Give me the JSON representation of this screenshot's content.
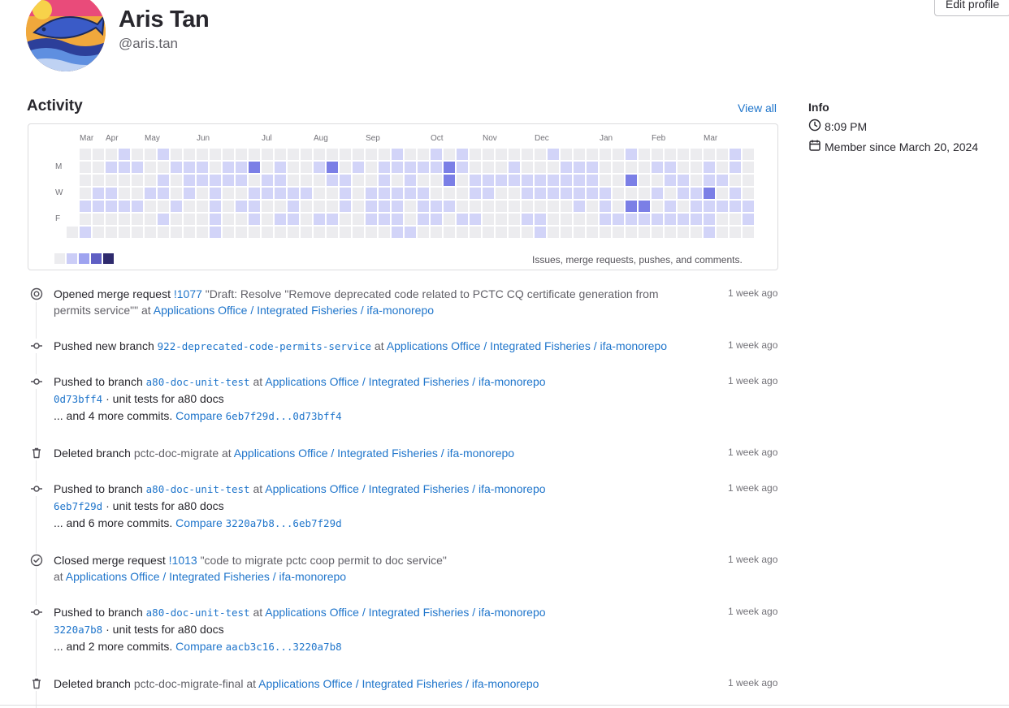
{
  "profile": {
    "name": "Aris Tan",
    "handle": "@aris.tan",
    "edit_label": "Edit profile"
  },
  "activity": {
    "title": "Activity",
    "view_all": "View all",
    "months": [
      "Mar",
      "Apr",
      "May",
      "Jun",
      "Jul",
      "Aug",
      "Sep",
      "Oct",
      "Nov",
      "Dec",
      "Jan",
      "Feb",
      "Mar"
    ],
    "day_labels": [
      "M",
      "W",
      "F"
    ],
    "legend_text": "Issues, merge requests, pushes, and comments.",
    "legend_colors": [
      "#ececef",
      "#cbcdf7",
      "#9ea3f0",
      "#5f5fc4",
      "#2e2a6d"
    ]
  },
  "info": {
    "title": "Info",
    "time": "8:09 PM",
    "member_since": "Member since March 20, 2024"
  },
  "events": [
    {
      "icon": "merge-request-open-icon",
      "lines": [
        [
          {
            "t": "Opened merge request "
          },
          {
            "t": "!1077",
            "link": true
          },
          {
            "t": " \"Draft: Resolve \"Remove deprecated code related to PCTC CQ certificate generation from",
            "muted": true
          }
        ],
        [
          {
            "t": "permits service\"\"",
            "muted": true
          },
          {
            "t": " at ",
            "muted": true
          },
          {
            "t": "Applications Office / Integrated Fisheries / ifa-monorepo",
            "link": true
          }
        ]
      ],
      "time": "1 week ago"
    },
    {
      "icon": "commit-icon",
      "lines": [
        [
          {
            "t": "Pushed new branch "
          },
          {
            "t": "922-deprecated-code-permits-service",
            "code": true
          },
          {
            "t": " at ",
            "muted": true
          },
          {
            "t": "Applications Office / Integrated Fisheries / ifa-monorepo",
            "link": true
          }
        ]
      ],
      "time": "1 week ago"
    },
    {
      "icon": "commit-icon",
      "lines": [
        [
          {
            "t": "Pushed to branch "
          },
          {
            "t": "a80-doc-unit-test",
            "code": true
          },
          {
            "t": " at ",
            "muted": true
          },
          {
            "t": "Applications Office / Integrated Fisheries / ifa-monorepo",
            "link": true
          }
        ],
        [
          {
            "t": "0d73bff4",
            "code": true
          },
          {
            "t": " · unit tests for a80 docs"
          }
        ],
        [
          {
            "t": "... and 4 more commits. "
          },
          {
            "t": "Compare ",
            "link": true
          },
          {
            "t": "6eb7f29d...0d73bff4",
            "code": true
          }
        ]
      ],
      "time": "1 week ago"
    },
    {
      "icon": "trash-icon",
      "lines": [
        [
          {
            "t": "Deleted branch "
          },
          {
            "t": "pctc-doc-migrate",
            "muted": true
          },
          {
            "t": " at ",
            "muted": true
          },
          {
            "t": "Applications Office / Integrated Fisheries / ifa-monorepo",
            "link": true
          }
        ]
      ],
      "time": "1 week ago"
    },
    {
      "icon": "commit-icon",
      "lines": [
        [
          {
            "t": "Pushed to branch "
          },
          {
            "t": "a80-doc-unit-test",
            "code": true
          },
          {
            "t": " at ",
            "muted": true
          },
          {
            "t": "Applications Office / Integrated Fisheries / ifa-monorepo",
            "link": true
          }
        ],
        [
          {
            "t": "6eb7f29d",
            "code": true
          },
          {
            "t": " · unit tests for a80 docs"
          }
        ],
        [
          {
            "t": "... and 6 more commits. "
          },
          {
            "t": "Compare ",
            "link": true
          },
          {
            "t": "3220a7b8...6eb7f29d",
            "code": true
          }
        ]
      ],
      "time": "1 week ago"
    },
    {
      "icon": "merge-request-closed-icon",
      "lines": [
        [
          {
            "t": "Closed merge request "
          },
          {
            "t": "!1013",
            "link": true
          },
          {
            "t": " \"code to migrate pctc coop permit to doc service\"",
            "muted": true
          }
        ],
        [
          {
            "t": "at ",
            "muted": true
          },
          {
            "t": "Applications Office / Integrated Fisheries / ifa-monorepo",
            "link": true
          }
        ]
      ],
      "time": "1 week ago"
    },
    {
      "icon": "commit-icon",
      "lines": [
        [
          {
            "t": "Pushed to branch "
          },
          {
            "t": "a80-doc-unit-test",
            "code": true
          },
          {
            "t": " at ",
            "muted": true
          },
          {
            "t": "Applications Office / Integrated Fisheries / ifa-monorepo",
            "link": true
          }
        ],
        [
          {
            "t": "3220a7b8",
            "code": true
          },
          {
            "t": " · unit tests for a80 docs"
          }
        ],
        [
          {
            "t": "... and 2 more commits. "
          },
          {
            "t": "Compare ",
            "link": true
          },
          {
            "t": "aacb3c16...3220a7b8",
            "code": true
          }
        ]
      ],
      "time": "1 week ago"
    },
    {
      "icon": "trash-icon",
      "lines": [
        [
          {
            "t": "Deleted branch "
          },
          {
            "t": "pctc-doc-migrate-final",
            "muted": true
          },
          {
            "t": " at ",
            "muted": true
          },
          {
            "t": "Applications Office / Integrated Fisheries / ifa-monorepo",
            "link": true
          }
        ]
      ],
      "time": "1 week ago"
    }
  ]
}
